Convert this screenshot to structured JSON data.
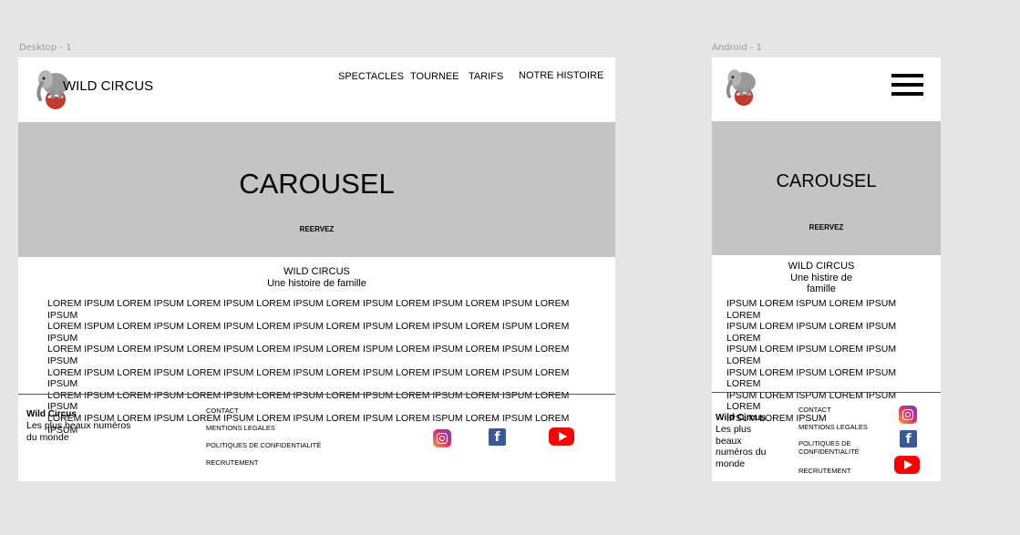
{
  "desktop": {
    "frame_label": "Desktop - 1",
    "brand": "WILD CIRCUS",
    "nav": [
      "SPECTACLES",
      "TOURNEE",
      "TARIFS",
      "NOTRE HISTOIRE"
    ],
    "hero_title": "CAROUSEL",
    "hero_button": "REERVEZ",
    "section_title": "WILD CIRCUS",
    "section_subtitle": "Une histoire de famille",
    "lorem": [
      "LOREM IPSUM LOREM IPSUM LOREM IPSUM LOREM IPSUM LOREM IPSUM LOREM IPSUM LOREM IPSUM LOREM IPSUM",
      "LOREM ISPUM LOREM IPSUM LOREM IPSUM LOREM IPSUM  LOREM IPSUM LOREM IPSUM LOREM ISPUM LOREM IPSUM",
      "LOREM IPSUM LOREM IPSUM LOREM IPSUM LOREM IPSUM LOREM ISPUM LOREM IPSUM LOREM IPSUM LOREM IPSUM",
      "LOREM IPSUM LOREM IPSUM LOREM IPSUM LOREM IPSUM LOREM IPSUM LOREM IPSUM LOREM IPSUM LOREM IPSUM",
      "LOREM IPSUM LOREM IPSUM LOREM IPSUM LOREM IPSUM LOREM IPSUM LOREM IPSUM LOREM ISPUM LOREM IPSUM",
      "LOREM IPSUM LOREM IPSUM LOREM IPSUM LOREM IPSUM LOREM IPSUM LOREM ISPUM LOREM IPSUM LOREM IPSUM"
    ],
    "footer_name": "Wild Circus",
    "footer_tagline": "Les plus beaux numéros du monde",
    "footer_links": [
      "CONTACT",
      "MENTIONS LEGALES",
      "POLITIQUES DE CONFIDENTIALITÉ",
      "RECRUTEMENT"
    ]
  },
  "android": {
    "frame_label": "Android - 1",
    "hero_title": "CAROUSEL",
    "hero_button": "REERVEZ",
    "section_title": "WILD CIRCUS",
    "section_subtitle": "Une histire de famille",
    "lorem": [
      "IPSUM LOREM ISPUM LOREM IPSUM LOREM",
      "IPSUM LOREM IPSUM LOREM IPSUM LOREM",
      "IPSUM LOREM IPSUM LOREM IPSUM LOREM",
      "IPSUM LOREM IPSUM LOREM IPSUM LOREM",
      "IPSUM LOREM ISPUM LOREM IPSUM LOREM",
      "IPSUM LOREM IPSUM"
    ],
    "footer_name": "Wild Circus",
    "footer_tagline": "Les plus beaux numéros du monde",
    "footer_links": [
      "CONTACT",
      "MENTIONS LEGALES",
      "POLITIQUES DE CONFIDENTIALITÉ",
      "RECRUTEMENT"
    ]
  },
  "icons": {
    "logo": "elephant-logo-icon",
    "menu": "hamburger-menu-icon",
    "instagram": "instagram-icon",
    "facebook": "facebook-icon",
    "youtube": "youtube-icon"
  },
  "colors": {
    "canvas": "#e5e5e5",
    "hero_placeholder": "#c4c4c4",
    "facebook": "#3b5998",
    "youtube": "#ff0000"
  }
}
